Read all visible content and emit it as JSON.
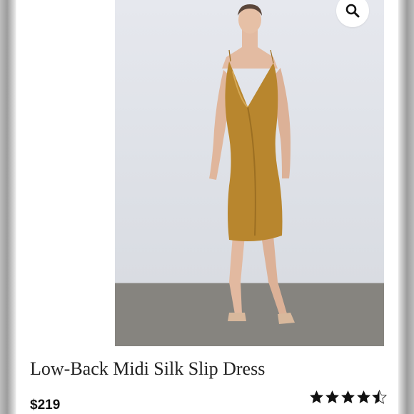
{
  "product": {
    "title": "Low-Back Midi Silk Slip Dress",
    "price": "$219",
    "rating": 4.5,
    "rating_max": 5,
    "review_count_text": "",
    "image_alt": "Model wearing gold silk slip dress"
  },
  "icons": {
    "zoom": "magnifier-icon",
    "star": "star-icon"
  },
  "colors": {
    "dress": "#b8862e",
    "background_wall": "#dfe2e8",
    "floor": "#858380",
    "text": "#222222"
  }
}
